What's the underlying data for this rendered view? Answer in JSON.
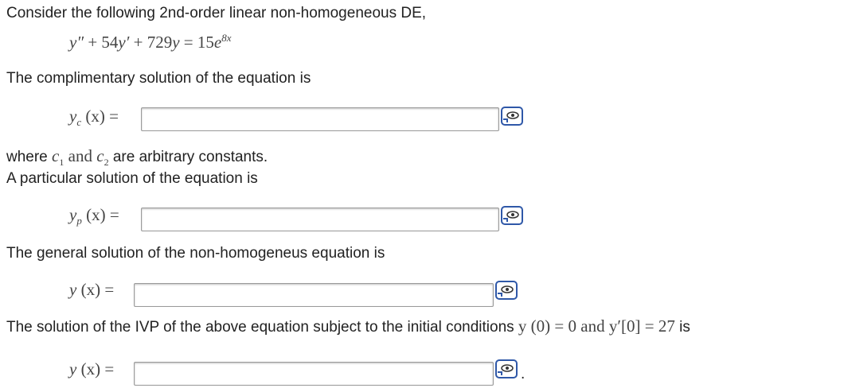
{
  "intro_text": "Consider the following 2nd-order linear non-homogeneous DE,",
  "equation": {
    "y2": "y″",
    "plus1": "+",
    "c1": "54",
    "y1": "y′",
    "plus2": "+",
    "c2": "729",
    "y0": "y",
    "equals": "=",
    "rhs_coef": "15",
    "rhs_base": "e",
    "rhs_exp": "8x"
  },
  "complementary_text": "The complimentary solution of the equation is",
  "yc_label": {
    "y": "y",
    "sub": "c",
    "arg": "(x)",
    "eq": "="
  },
  "arb_text": {
    "where": "where",
    "c1": "c",
    "c1_sub": "1",
    "and": "and",
    "c2": "c",
    "c2_sub": "2",
    "rest": "are arbitrary constants."
  },
  "particular_text": "A particular solution of the equation is",
  "yp_label": {
    "y": "y",
    "sub": "p",
    "arg": "(x)",
    "eq": "="
  },
  "general_text": "The general solution of the non-homogeneus equation is",
  "y_label": {
    "y": "y",
    "arg": "(x)",
    "eq": "="
  },
  "ivp_text": {
    "lead": "The solution of the IVP of the above equation subject to the initial conditions",
    "cond1": "y (0) = 0",
    "and": "and",
    "cond2": "y′[0] = 27",
    "is": "is"
  },
  "y_label2": {
    "y": "y",
    "arg": "(x)",
    "eq": "="
  },
  "period": ".",
  "answers": {
    "yc": "",
    "yp": "",
    "general": "",
    "ivp": ""
  },
  "icon": "equation-editor-icon"
}
